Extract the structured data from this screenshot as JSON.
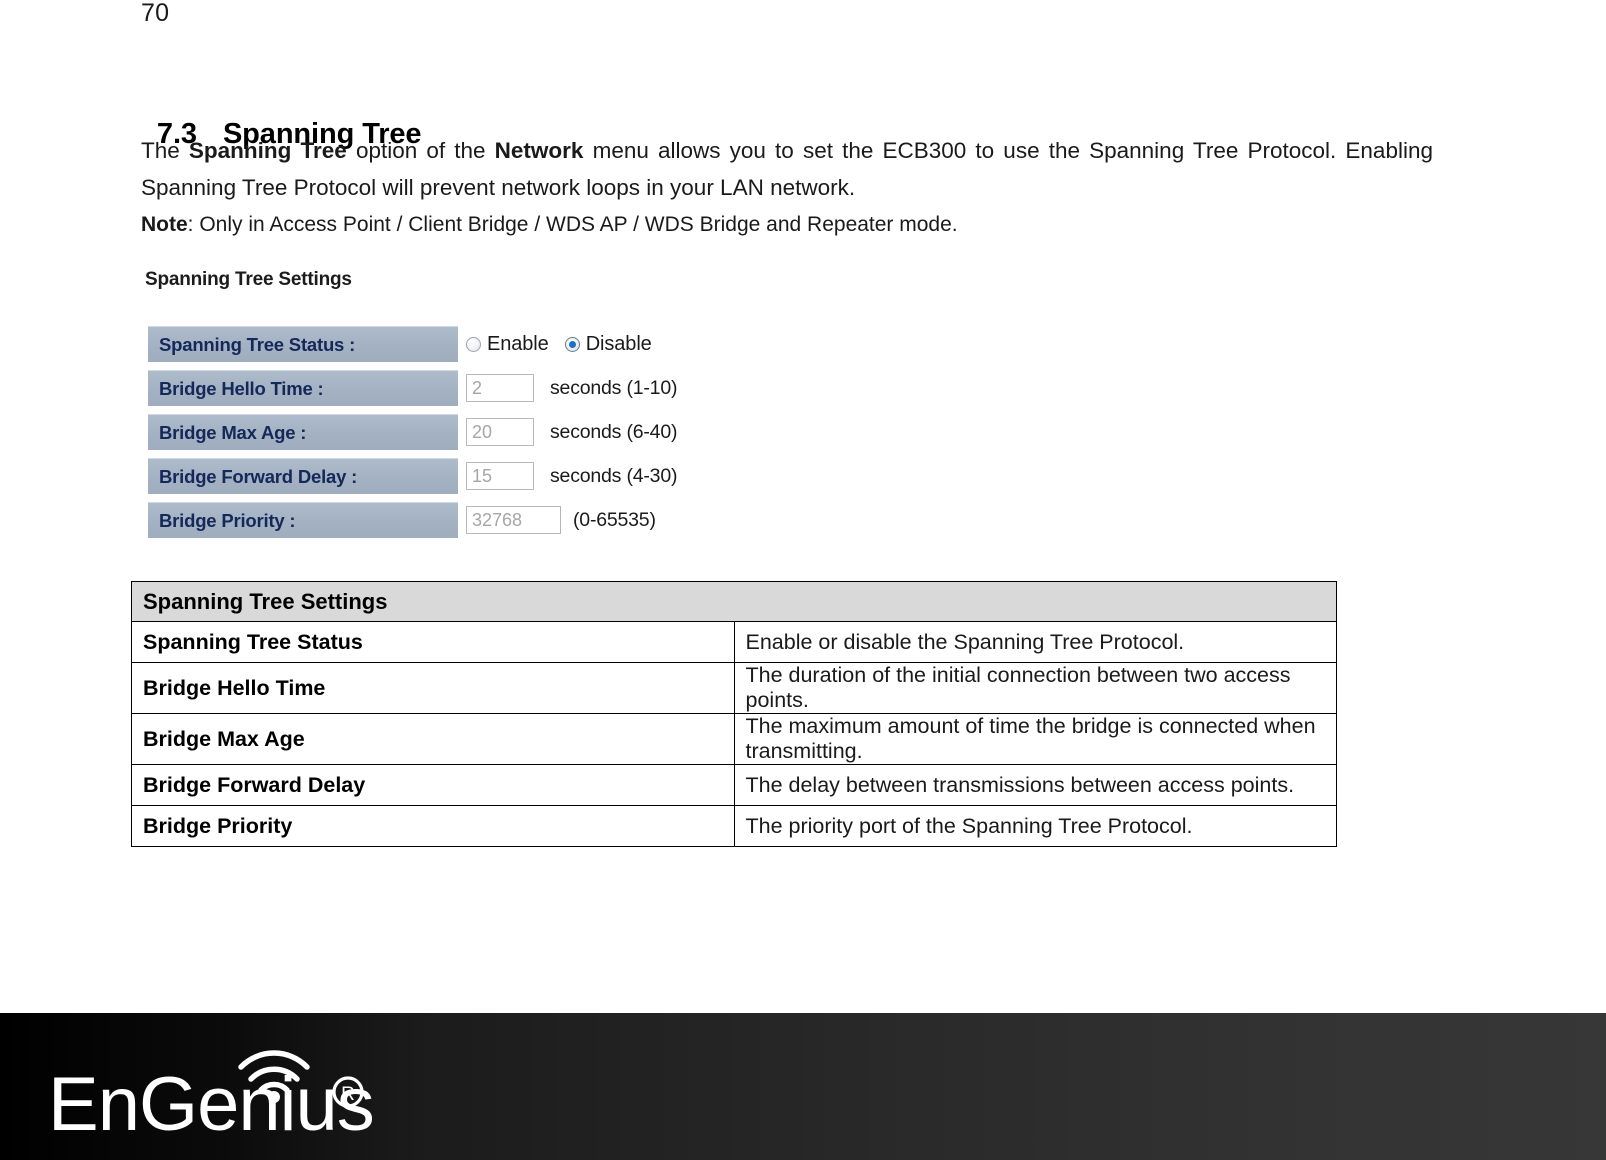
{
  "page": {
    "number": "70"
  },
  "heading": {
    "number": "7.3",
    "title": "Spanning Tree"
  },
  "intro": {
    "p1_part1": "The ",
    "p1_bold1": "Spanning Tree",
    "p1_part2": " option of the ",
    "p1_bold2": "Network",
    "p1_part3": " menu allows you to set the ECB300 to use the Spanning Tree Protocol. Enabling Spanning Tree Protocol will prevent network loops in your LAN network.",
    "note_label": "Note",
    "note_text": ": Only in Access Point / Client Bridge / WDS AP / WDS Bridge and Repeater mode."
  },
  "ui_panel": {
    "title": "Spanning Tree Settings",
    "rows": [
      {
        "label": "Spanning Tree Status :",
        "control": "radio",
        "options": [
          {
            "label": "Enable",
            "selected": false
          },
          {
            "label": "Disable",
            "selected": true
          }
        ]
      },
      {
        "label": "Bridge Hello Time :",
        "control": "input",
        "value": "2",
        "hint": "seconds (1-10)"
      },
      {
        "label": "Bridge Max Age :",
        "control": "input",
        "value": "20",
        "hint": "seconds (6-40)"
      },
      {
        "label": "Bridge Forward Delay :",
        "control": "input",
        "value": "15",
        "hint": "seconds (4-30)"
      },
      {
        "label": "Bridge Priority :",
        "control": "input",
        "value": "32768",
        "hint": "(0-65535)"
      }
    ]
  },
  "desc_table": {
    "header": "Spanning Tree Settings",
    "rows": [
      {
        "term": "Spanning Tree Status",
        "description": "Enable or disable the Spanning Tree Protocol."
      },
      {
        "term": "Bridge Hello Time",
        "description": "The duration of the initial connection between two access points."
      },
      {
        "term": "Bridge Max Age",
        "description": "The maximum amount of time the bridge is connected when transmitting."
      },
      {
        "term": "Bridge Forward Delay",
        "description": "The delay between transmissions between access points."
      },
      {
        "term": "Bridge Priority",
        "description": "The priority port of the Spanning Tree Protocol."
      }
    ]
  },
  "footer": {
    "brand": "EnGenius",
    "trademark": "®"
  },
  "colors": {
    "label_cell_bg": "#a3b1c2",
    "label_cell_text": "#14285a",
    "table_header_bg": "#d9d9d9",
    "radio_accent": "#1b6fc4",
    "footer_start": "#000000",
    "footer_end": "#373737"
  }
}
